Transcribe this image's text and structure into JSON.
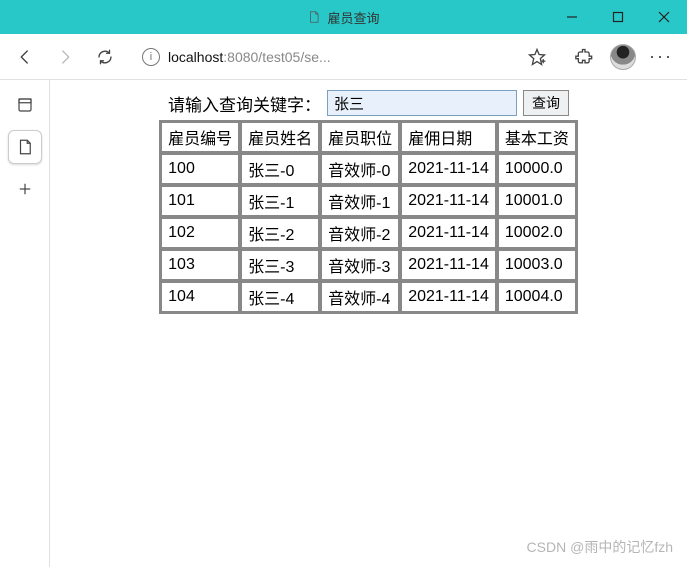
{
  "window": {
    "title": "雇员查询",
    "controls": {
      "min": "minimize",
      "max": "maximize",
      "close": "close"
    }
  },
  "toolbar": {
    "url_host": "localhost",
    "url_rest": ":8080/test05/se..."
  },
  "search": {
    "label": "请输入查询关键字：",
    "value": "张三",
    "button": "查询"
  },
  "table": {
    "headers": [
      "雇员编号",
      "雇员姓名",
      "雇员职位",
      "雇佣日期",
      "基本工资"
    ],
    "rows": [
      [
        "100",
        "张三-0",
        "音效师-0",
        "2021-11-14",
        "10000.0"
      ],
      [
        "101",
        "张三-1",
        "音效师-1",
        "2021-11-14",
        "10001.0"
      ],
      [
        "102",
        "张三-2",
        "音效师-2",
        "2021-11-14",
        "10002.0"
      ],
      [
        "103",
        "张三-3",
        "音效师-3",
        "2021-11-14",
        "10003.0"
      ],
      [
        "104",
        "张三-4",
        "音效师-4",
        "2021-11-14",
        "10004.0"
      ]
    ]
  },
  "watermark": "CSDN @雨中的记忆fzh"
}
